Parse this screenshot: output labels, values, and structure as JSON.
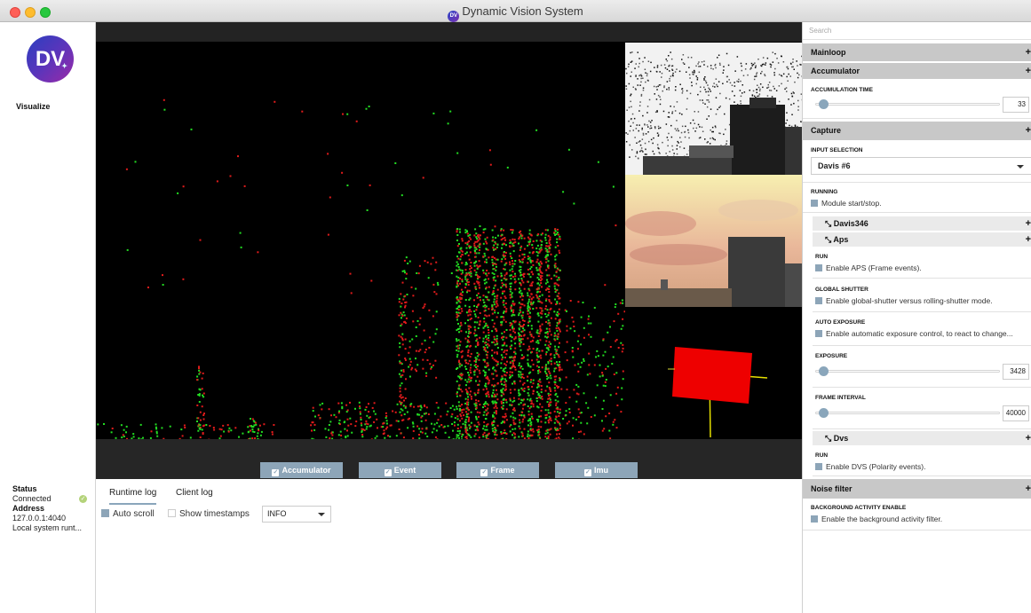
{
  "window": {
    "title": "Dynamic Vision System",
    "logo_text": "DV"
  },
  "sidebar": {
    "logo_text": "DV",
    "nav_visualize": "Visualize",
    "status_label": "Status",
    "status_value": "Connected",
    "address_label": "Address",
    "address_value": "127.0.0.1:4040",
    "system_value": "Local system runt..."
  },
  "visualizer": {
    "checkboxes": [
      "Accumulator",
      "Event",
      "Frame",
      "Imu"
    ]
  },
  "log": {
    "tab_runtime": "Runtime log",
    "tab_client": "Client log",
    "auto_scroll": "Auto scroll",
    "show_timestamps": "Show timestamps",
    "level": "INFO"
  },
  "config": {
    "search_placeholder": "Search",
    "plus": "+",
    "mainloop": "Mainloop",
    "accumulator": "Accumulator",
    "accumulation_time_label": "ACCUMULATION TIME",
    "accumulation_time_value": "33",
    "accumulation_time_fraction": 0.02,
    "capture": "Capture",
    "input_selection_label": "INPUT SELECTION",
    "input_selection_value": "Davis #6",
    "running_label": "RUNNING",
    "running_desc": "Module start/stop.",
    "davis346": "Davis346",
    "aps": "Aps",
    "aps_run_label": "RUN",
    "aps_run_desc": "Enable APS (Frame events).",
    "global_shutter_label": "GLOBAL SHUTTER",
    "global_shutter_desc": "Enable global-shutter versus rolling-shutter mode.",
    "auto_exposure_label": "AUTO EXPOSURE",
    "auto_exposure_desc": "Enable automatic exposure control, to react to change...",
    "exposure_label": "EXPOSURE",
    "exposure_value": "3428",
    "exposure_fraction": 0.02,
    "frame_interval_label": "FRAME INTERVAL",
    "frame_interval_value": "40000",
    "frame_interval_fraction": 0.02,
    "dvs": "Dvs",
    "dvs_run_label": "RUN",
    "dvs_run_desc": "Enable DVS (Polarity events).",
    "noise_filter": "Noise filter",
    "bg_activity_label": "BACKGROUND ACTIVITY ENABLE",
    "bg_activity_desc": "Enable the background activity filter."
  },
  "colors": {
    "accent": "#8da5b8",
    "event_on": "#22dd22",
    "event_off": "#e11b1b"
  }
}
